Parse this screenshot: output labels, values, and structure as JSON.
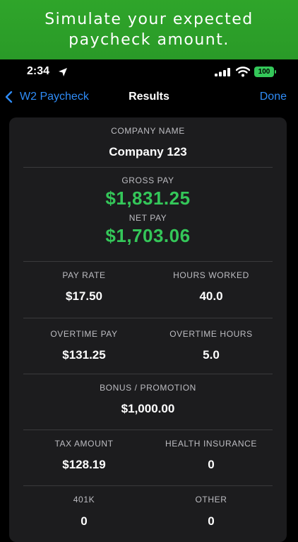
{
  "promo": {
    "line1": "Simulate your expected",
    "line2": "paycheck amount."
  },
  "status": {
    "time": "2:34",
    "battery": "100"
  },
  "nav": {
    "back": "W2 Paycheck",
    "title": "Results",
    "done": "Done"
  },
  "company": {
    "label": "COMPANY NAME",
    "value": "Company 123"
  },
  "pay": {
    "gross_label": "GROSS PAY",
    "gross_value": "$1,831.25",
    "net_label": "NET PAY",
    "net_value": "$1,703.06"
  },
  "rows": {
    "pay_rate_label": "PAY RATE",
    "pay_rate_value": "$17.50",
    "hours_label": "HOURS WORKED",
    "hours_value": "40.0",
    "ot_pay_label": "OVERTIME PAY",
    "ot_pay_value": "$131.25",
    "ot_hours_label": "OVERTIME HOURS",
    "ot_hours_value": "5.0",
    "bonus_label": "BONUS / PROMOTION",
    "bonus_value": "$1,000.00",
    "tax_label": "TAX AMOUNT",
    "tax_value": "$128.19",
    "health_label": "HEALTH INSURANCE",
    "health_value": "0",
    "k401_label": "401K",
    "k401_value": "0",
    "other_label": "OTHER",
    "other_value": "0"
  },
  "colors": {
    "accent_blue": "#2f8cf7",
    "money_green": "#34c759",
    "promo_green": "#2fa52a"
  },
  "icons": [
    "location-arrow-icon",
    "cellular-signal-icon",
    "wifi-icon",
    "battery-icon",
    "chevron-left-icon"
  ]
}
